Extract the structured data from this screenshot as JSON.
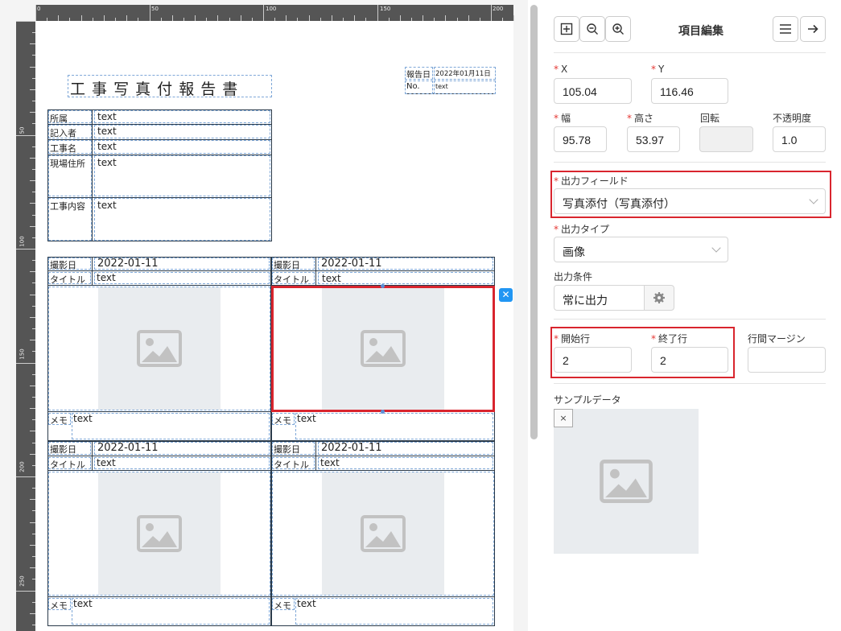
{
  "ruler": {
    "top_labels": [
      "0",
      "50",
      "100",
      "150",
      "200"
    ],
    "left_labels": [
      "50",
      "100",
      "150",
      "200",
      "250"
    ]
  },
  "report": {
    "title": "工 事 写 真 付 報 告 書",
    "date_label": "報告日",
    "date_value": "2022年01月11日",
    "no_label": "No.",
    "no_value": "text",
    "info_rows": [
      {
        "label": "所属",
        "value": "text"
      },
      {
        "label": "記入者",
        "value": "text"
      },
      {
        "label": "工事名",
        "value": "text"
      },
      {
        "label": "現場住所",
        "value": "text"
      },
      {
        "label": "工事内容",
        "value": "text"
      }
    ]
  },
  "photos": [
    {
      "date_label": "撮影日",
      "date": "2022-01-11",
      "title_label": "タイトル",
      "title": "text",
      "memo_label": "メモ",
      "memo": "text"
    },
    {
      "date_label": "撮影日",
      "date": "2022-01-11",
      "title_label": "タイトル",
      "title": "text",
      "memo_label": "メモ",
      "memo": "text"
    },
    {
      "date_label": "撮影日",
      "date": "2022-01-11",
      "title_label": "タイトル",
      "title": "text",
      "memo_label": "メモ",
      "memo": "text"
    },
    {
      "date_label": "撮影日",
      "date": "2022-01-11",
      "title_label": "タイトル",
      "title": "text",
      "memo_label": "メモ",
      "memo": "text"
    }
  ],
  "panel": {
    "title": "項目編集",
    "x_label": "X",
    "x_value": "105.04",
    "y_label": "Y",
    "y_value": "116.46",
    "width_label": "幅",
    "width_value": "95.78",
    "height_label": "高さ",
    "height_value": "53.97",
    "rotation_label": "回転",
    "rotation_value": "",
    "opacity_label": "不透明度",
    "opacity_value": "1.0",
    "output_field_label": "出力フィールド",
    "output_field_value": "写真添付（写真添付）",
    "output_type_label": "出力タイプ",
    "output_type_value": "画像",
    "output_condition_label": "出力条件",
    "output_condition_value": "常に出力",
    "start_row_label": "開始行",
    "start_row_value": "2",
    "end_row_label": "終了行",
    "end_row_value": "2",
    "line_margin_label": "行間マージン",
    "line_margin_value": "",
    "sample_data_label": "サンプルデータ",
    "sample_clear": "×"
  },
  "colors": {
    "highlight": "#d9252e",
    "accent": "#2196f3"
  }
}
